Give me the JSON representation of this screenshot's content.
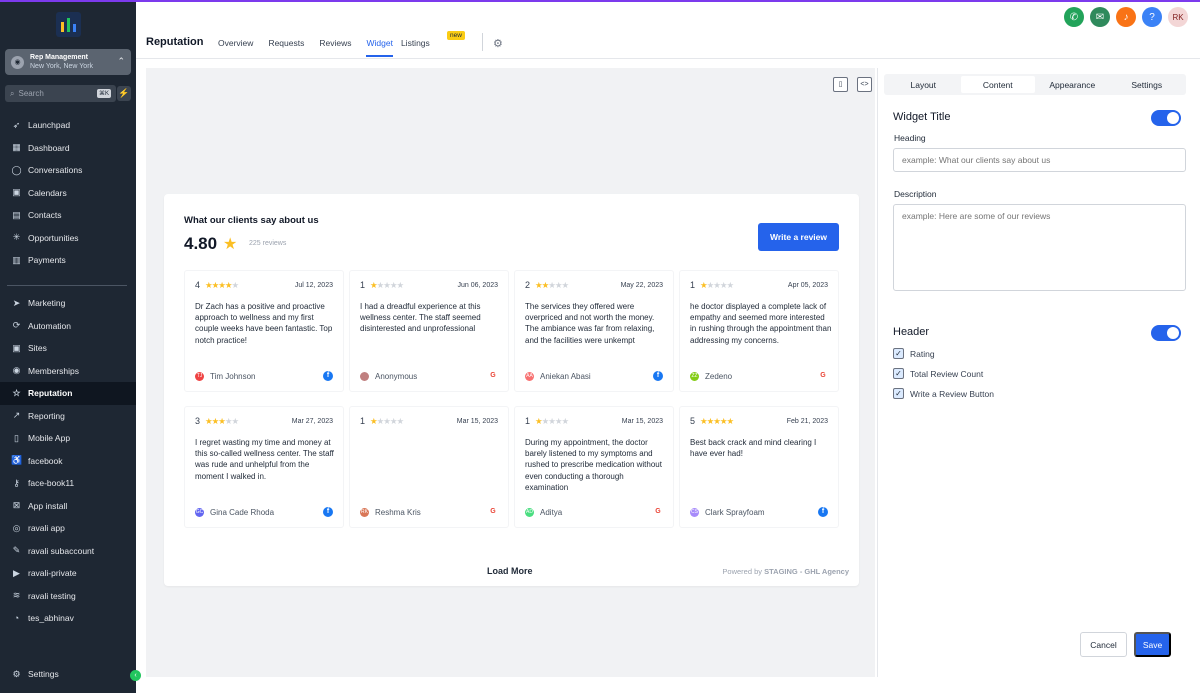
{
  "sidebar": {
    "account": {
      "name": "Rep Management",
      "location": "New York, New York"
    },
    "search": {
      "placeholder": "Search",
      "shortcut": "⌘K"
    },
    "items": [
      {
        "label": "Launchpad",
        "icon": "rocket-icon"
      },
      {
        "label": "Dashboard",
        "icon": "grid-icon"
      },
      {
        "label": "Conversations",
        "icon": "chat-icon"
      },
      {
        "label": "Calendars",
        "icon": "calendar-icon"
      },
      {
        "label": "Contacts",
        "icon": "contacts-icon"
      },
      {
        "label": "Opportunities",
        "icon": "funnel-icon"
      },
      {
        "label": "Payments",
        "icon": "receipt-icon"
      }
    ],
    "items2": [
      {
        "label": "Marketing",
        "icon": "send-icon"
      },
      {
        "label": "Automation",
        "icon": "automation-icon"
      },
      {
        "label": "Sites",
        "icon": "globe-icon"
      },
      {
        "label": "Memberships",
        "icon": "membership-icon"
      },
      {
        "label": "Reputation",
        "icon": "star-icon",
        "active": true
      },
      {
        "label": "Reporting",
        "icon": "chart-icon"
      },
      {
        "label": "Mobile App",
        "icon": "phone-icon"
      },
      {
        "label": "facebook",
        "icon": "accessibility-icon"
      },
      {
        "label": "face-book11",
        "icon": "key-icon"
      },
      {
        "label": "App install",
        "icon": "close-box-icon"
      },
      {
        "label": "ravali app",
        "icon": "vr-icon"
      },
      {
        "label": "ravali subaccount",
        "icon": "wrench-icon"
      },
      {
        "label": "ravali-private",
        "icon": "video-icon"
      },
      {
        "label": "ravali testing",
        "icon": "wifi-icon"
      },
      {
        "label": "tes_abhinav",
        "icon": "pie-icon"
      }
    ],
    "settings_label": "Settings"
  },
  "header": {
    "title": "Reputation",
    "tabs": [
      "Overview",
      "Requests",
      "Reviews",
      "Widget",
      "Listings"
    ],
    "active_tab": "Widget",
    "new_badge": "new",
    "user_initials": "RK",
    "colors": {
      "phone": "#22a35a",
      "megaphone": "#2f8a5c",
      "bell": "#f97316",
      "help": "#3b82f6",
      "avatar": "#f3d6d6"
    }
  },
  "widget": {
    "title": "What our clients say about us",
    "rating": "4.80",
    "review_count": "225 reviews",
    "write_button": "Write a review",
    "load_more": "Load More",
    "powered_prefix": "Powered by",
    "powered_by": "STAGING - GHL Agency",
    "reviews": [
      {
        "rating": "4",
        "stars": 4,
        "date": "Jul 12, 2023",
        "text": "Dr Zach has a positive and proactive approach to wellness and my first couple weeks have been fantastic. Top notch practice!",
        "name": "Tim Johnson",
        "initials": "TJ",
        "avatar_color": "#ef4444",
        "source": "facebook"
      },
      {
        "rating": "1",
        "stars": 1,
        "date": "Jun 06, 2023",
        "text": "I had a dreadful experience at this wellness center. The staff seemed disinterested and unprofessional",
        "name": "Anonymous",
        "initials": "",
        "avatar_color": "#c08080",
        "source": "google"
      },
      {
        "rating": "2",
        "stars": 2,
        "date": "May 22, 2023",
        "text": "The services they offered were overpriced and not worth the money. The ambiance was far from relaxing, and the facilities were unkempt",
        "name": "Aniekan Abasi",
        "initials": "AA",
        "avatar_color": "#f87171",
        "source": "facebook"
      },
      {
        "rating": "1",
        "stars": 1,
        "date": "Apr 05, 2023",
        "text": "he doctor displayed a complete lack of empathy and seemed more interested in rushing through the appointment than addressing my concerns.",
        "name": "Zedeno",
        "initials": "ZZ",
        "avatar_color": "#84cc16",
        "source": "google"
      },
      {
        "rating": "3",
        "stars": 3,
        "date": "Mar 27, 2023",
        "text": "I regret wasting my time and money at this so-called wellness center. The staff was rude and unhelpful from the moment I walked in.",
        "name": "Gina Cade Rhoda",
        "initials": "GC",
        "avatar_color": "#6366f1",
        "source": "facebook"
      },
      {
        "rating": "1",
        "stars": 1,
        "date": "Mar 15, 2023",
        "text": "",
        "name": "Reshma Kris",
        "initials": "RK",
        "avatar_color": "#d97757",
        "source": "google"
      },
      {
        "rating": "1",
        "stars": 1,
        "date": "Mar 15, 2023",
        "text": "During my appointment, the doctor barely listened to my symptoms and rushed to prescribe medication without even conducting a thorough examination",
        "name": "Aditya",
        "initials": "AD",
        "avatar_color": "#4ade80",
        "source": "google"
      },
      {
        "rating": "5",
        "stars": 5,
        "date": "Feb 21, 2023",
        "text": "Best back crack and mind clearing I have ever had!",
        "name": "Clark Sprayfoam",
        "initials": "CS",
        "avatar_color": "#a78bfa",
        "source": "facebook"
      }
    ]
  },
  "panel": {
    "tabs": [
      "Layout",
      "Content",
      "Appearance",
      "Settings"
    ],
    "active_tab": "Content",
    "widget_title_label": "Widget Title",
    "widget_title_on": true,
    "heading_label": "Heading",
    "heading_placeholder": "example: What our clients say about us",
    "description_label": "Description",
    "description_placeholder": "example: Here are some of our reviews",
    "header_label": "Header",
    "header_on": true,
    "checkboxes": [
      {
        "label": "Rating",
        "checked": true
      },
      {
        "label": "Total Review Count",
        "checked": true
      },
      {
        "label": "Write a Review Button",
        "checked": true
      }
    ],
    "cancel": "Cancel",
    "save": "Save"
  }
}
